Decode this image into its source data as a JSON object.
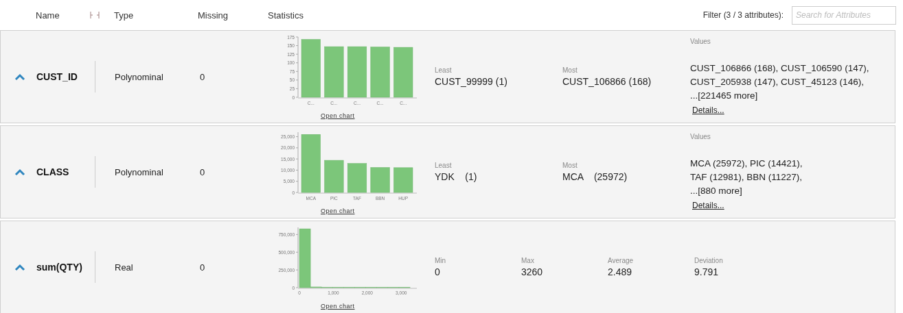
{
  "header": {
    "columns": [
      "Name",
      "Type",
      "Missing",
      "Statistics"
    ],
    "filter_label": "Filter (3 / 3 attributes):",
    "search": {
      "placeholder": "Search for Attributes"
    }
  },
  "attributes": [
    {
      "name": "CUST_ID",
      "expanded": true,
      "type": "Polynominal",
      "missing": "0",
      "kind": "nominal",
      "chart_data": {
        "type": "bar",
        "categories": [
          "C...",
          "C...",
          "C...",
          "C...",
          "C..."
        ],
        "values": [
          168,
          147,
          147,
          146,
          145
        ],
        "ylim": [
          0,
          175
        ],
        "yticks": [
          0,
          25,
          50,
          75,
          100,
          125,
          150,
          175
        ]
      },
      "chart_link": "Open chart",
      "stats": [
        {
          "label": "Least",
          "value": "CUST_99999 (1)"
        },
        {
          "label": "Most",
          "value": "CUST_106866 (168)"
        }
      ],
      "values": {
        "label": "Values",
        "lines": [
          "CUST_106866 (168), CUST_106590 (147),",
          "CUST_205938 (147), CUST_45123 (146),",
          "...[221465 more]"
        ],
        "link": "Details..."
      }
    },
    {
      "name": "CLASS",
      "expanded": true,
      "type": "Polynominal",
      "missing": "0",
      "kind": "nominal",
      "chart_data": {
        "type": "bar",
        "categories": [
          "MCA",
          "PIC",
          "TAF",
          "BBN",
          "HUP"
        ],
        "values": [
          26000,
          14400,
          13000,
          11200,
          11100
        ],
        "ylim": [
          0,
          27000
        ],
        "yticks": [
          {
            "value": 0,
            "label": "0"
          },
          {
            "value": 5000,
            "label": "5,000"
          },
          {
            "value": 10000,
            "label": "10,000"
          },
          {
            "value": 15000,
            "label": "15,000"
          },
          {
            "value": 20000,
            "label": "20,000"
          },
          {
            "value": 25000,
            "label": "25,000"
          }
        ]
      },
      "chart_link": "Open chart",
      "stats": [
        {
          "label": "Least",
          "value": "YDK    (1)"
        },
        {
          "label": "Most",
          "value": "MCA    (25972)"
        }
      ],
      "values": {
        "label": "Values",
        "lines": [
          "MCA (25972), PIC (14421),",
          "TAF (12981), BBN (11227),",
          "...[880 more]"
        ],
        "link": "Details..."
      }
    },
    {
      "name": "sum(QTY)",
      "expanded": true,
      "type": "Real",
      "missing": "0",
      "kind": "numeric",
      "chart_data": {
        "type": "bar",
        "x": [
          163,
          489,
          815,
          1141,
          1467,
          1793,
          2119,
          2445,
          2771,
          3097
        ],
        "values": [
          830000,
          10000,
          0,
          0,
          0,
          0,
          0,
          0,
          0,
          0
        ],
        "xlim": [
          0,
          3400
        ],
        "ylim": [
          0,
          850000
        ],
        "xticks": [
          {
            "value": 0,
            "label": "0"
          },
          {
            "value": 1000,
            "label": "1,000"
          },
          {
            "value": 2000,
            "label": "2,000"
          },
          {
            "value": 3000,
            "label": "3,000"
          }
        ],
        "yticks": [
          {
            "value": 0,
            "label": "0"
          },
          {
            "value": 250000,
            "label": "250,000"
          },
          {
            "value": 500000,
            "label": "500,000"
          },
          {
            "value": 750000,
            "label": "750,000"
          }
        ]
      },
      "chart_link": "Open chart",
      "stats": [
        {
          "label": "Min",
          "value": "0"
        },
        {
          "label": "Max",
          "value": "3260"
        },
        {
          "label": "Average",
          "value": "2.489"
        },
        {
          "label": "Deviation",
          "value": "9.791"
        }
      ]
    }
  ]
}
